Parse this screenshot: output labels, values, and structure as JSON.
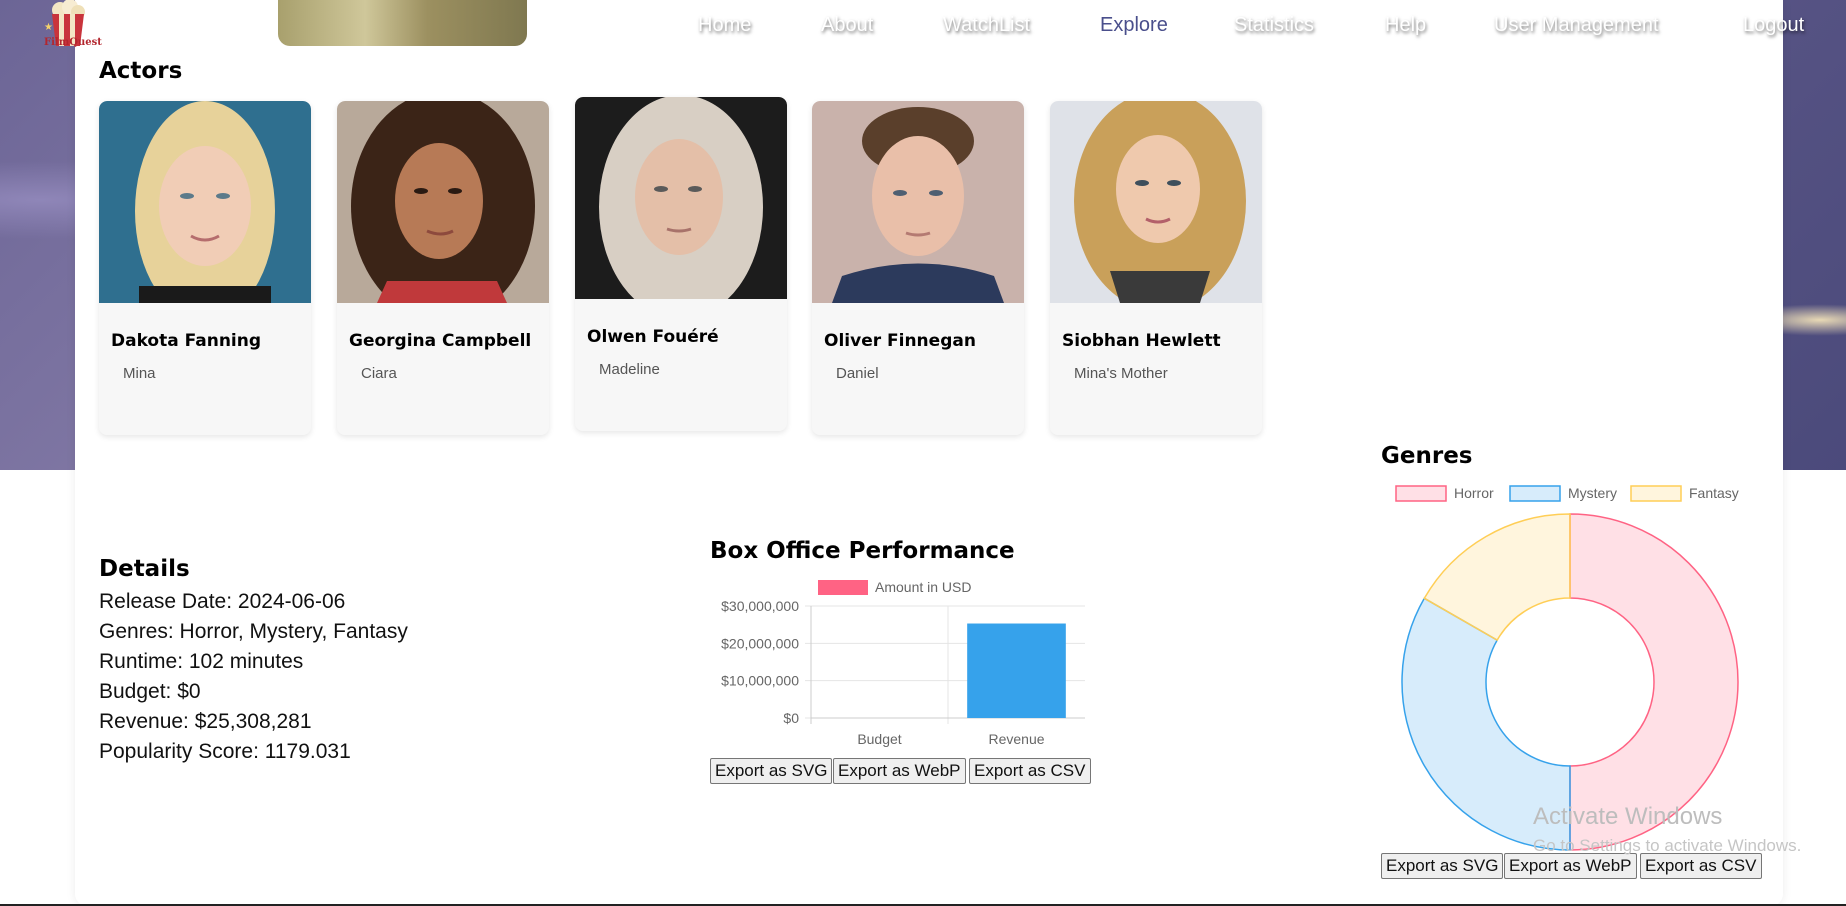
{
  "app": {
    "logo_text": "FilmQuest"
  },
  "nav": {
    "items": [
      {
        "label": "Home"
      },
      {
        "label": "About"
      },
      {
        "label": "WatchList"
      },
      {
        "label": "Explore"
      },
      {
        "label": "Statistics"
      },
      {
        "label": "Help"
      },
      {
        "label": "User Management"
      },
      {
        "label": "Logout"
      }
    ],
    "active": "Explore"
  },
  "actors": {
    "title": "Actors",
    "items": [
      {
        "name": "Dakota Fanning",
        "role": "Mina"
      },
      {
        "name": "Georgina Campbell",
        "role": "Ciara"
      },
      {
        "name": "Olwen Fouéré",
        "role": "Madeline"
      },
      {
        "name": "Oliver Finnegan",
        "role": "Daniel"
      },
      {
        "name": "Siobhan Hewlett",
        "role": "Mina's Mother"
      }
    ]
  },
  "details": {
    "title": "Details",
    "release_date": "Release Date: 2024-06-06",
    "genres": "Genres: Horror, Mystery, Fantasy",
    "runtime": "Runtime: 102 minutes",
    "budget": "Budget: $0",
    "revenue": "Revenue: $25,308,281",
    "popularity": "Popularity Score: 1179.031"
  },
  "box_office": {
    "title": "Box Office Performance",
    "export_svg": "Export as SVG",
    "export_webp": "Export as WebP",
    "export_csv": "Export as CSV"
  },
  "genres_panel": {
    "title": "Genres",
    "export_svg": "Export as SVG",
    "export_webp": "Export as WebP",
    "export_csv": "Export as CSV"
  },
  "watermark": {
    "line1": "Activate Windows",
    "line2": "Go to Settings to activate Windows."
  },
  "colors": {
    "accent_nav": "#4a4f8c",
    "bar_legend": "#ff6384",
    "bar_fill": "#36a2eb",
    "horror": "#ff6384",
    "mystery": "#36a2eb",
    "fantasy": "#ffce56"
  },
  "chart_data": [
    {
      "type": "bar",
      "categories": [
        "Budget",
        "Revenue"
      ],
      "series": [
        {
          "name": "Amount in USD",
          "values": [
            0,
            25308281
          ]
        }
      ],
      "yticks": [
        "$0",
        "$10,000,000",
        "$20,000,000",
        "$30,000,000"
      ],
      "ylim": [
        0,
        30000000
      ],
      "grid": true,
      "legend": "top"
    },
    {
      "type": "pie",
      "categories": [
        "Horror",
        "Mystery",
        "Fantasy"
      ],
      "values": [
        50,
        33.3,
        16.7
      ],
      "legend": "top"
    }
  ]
}
